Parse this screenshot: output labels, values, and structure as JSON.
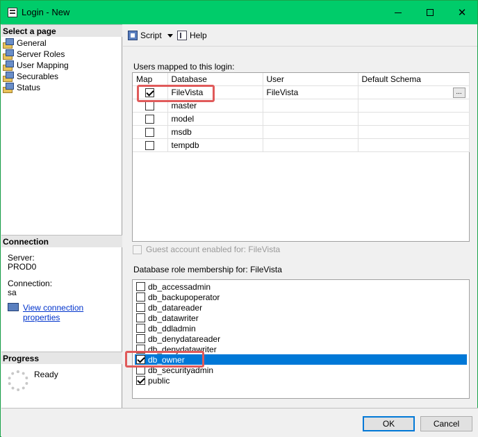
{
  "window": {
    "title": "Login - New"
  },
  "left": {
    "select_page_header": "Select a page",
    "pages": [
      {
        "label": "General"
      },
      {
        "label": "Server Roles"
      },
      {
        "label": "User Mapping"
      },
      {
        "label": "Securables"
      },
      {
        "label": "Status"
      }
    ],
    "connection_header": "Connection",
    "server_label": "Server:",
    "server_value": "PROD0",
    "connection_label": "Connection:",
    "connection_value": "sa",
    "view_props_link": "View connection properties",
    "progress_header": "Progress",
    "progress_status": "Ready"
  },
  "toolbar": {
    "script_label": "Script",
    "help_label": "Help"
  },
  "users_mapped": {
    "label": "Users mapped to this login:",
    "columns": [
      "Map",
      "Database",
      "User",
      "Default Schema"
    ],
    "rows": [
      {
        "map": true,
        "database": "FileVista",
        "user": "FileVista",
        "schema": ""
      },
      {
        "map": false,
        "database": "master",
        "user": "",
        "schema": ""
      },
      {
        "map": false,
        "database": "model",
        "user": "",
        "schema": ""
      },
      {
        "map": false,
        "database": "msdb",
        "user": "",
        "schema": ""
      },
      {
        "map": false,
        "database": "tempdb",
        "user": "",
        "schema": ""
      }
    ],
    "ellipsis": "..."
  },
  "guest": {
    "label": "Guest account enabled for: FileVista",
    "checked": false
  },
  "roles": {
    "label": "Database role membership for: FileVista",
    "items": [
      {
        "label": "db_accessadmin",
        "checked": false
      },
      {
        "label": "db_backupoperator",
        "checked": false
      },
      {
        "label": "db_datareader",
        "checked": false
      },
      {
        "label": "db_datawriter",
        "checked": false
      },
      {
        "label": "db_ddladmin",
        "checked": false
      },
      {
        "label": "db_denydatareader",
        "checked": false
      },
      {
        "label": "db_denydatawriter",
        "checked": false
      },
      {
        "label": "db_owner",
        "checked": true,
        "selected": true
      },
      {
        "label": "db_securityadmin",
        "checked": false
      },
      {
        "label": "public",
        "checked": true
      }
    ]
  },
  "footer": {
    "ok_label": "OK",
    "cancel_label": "Cancel"
  },
  "colors": {
    "titlebar": "#00cc6a",
    "selection": "#0078d7",
    "highlight_box": "#e05a5a",
    "link": "#0033cc"
  }
}
